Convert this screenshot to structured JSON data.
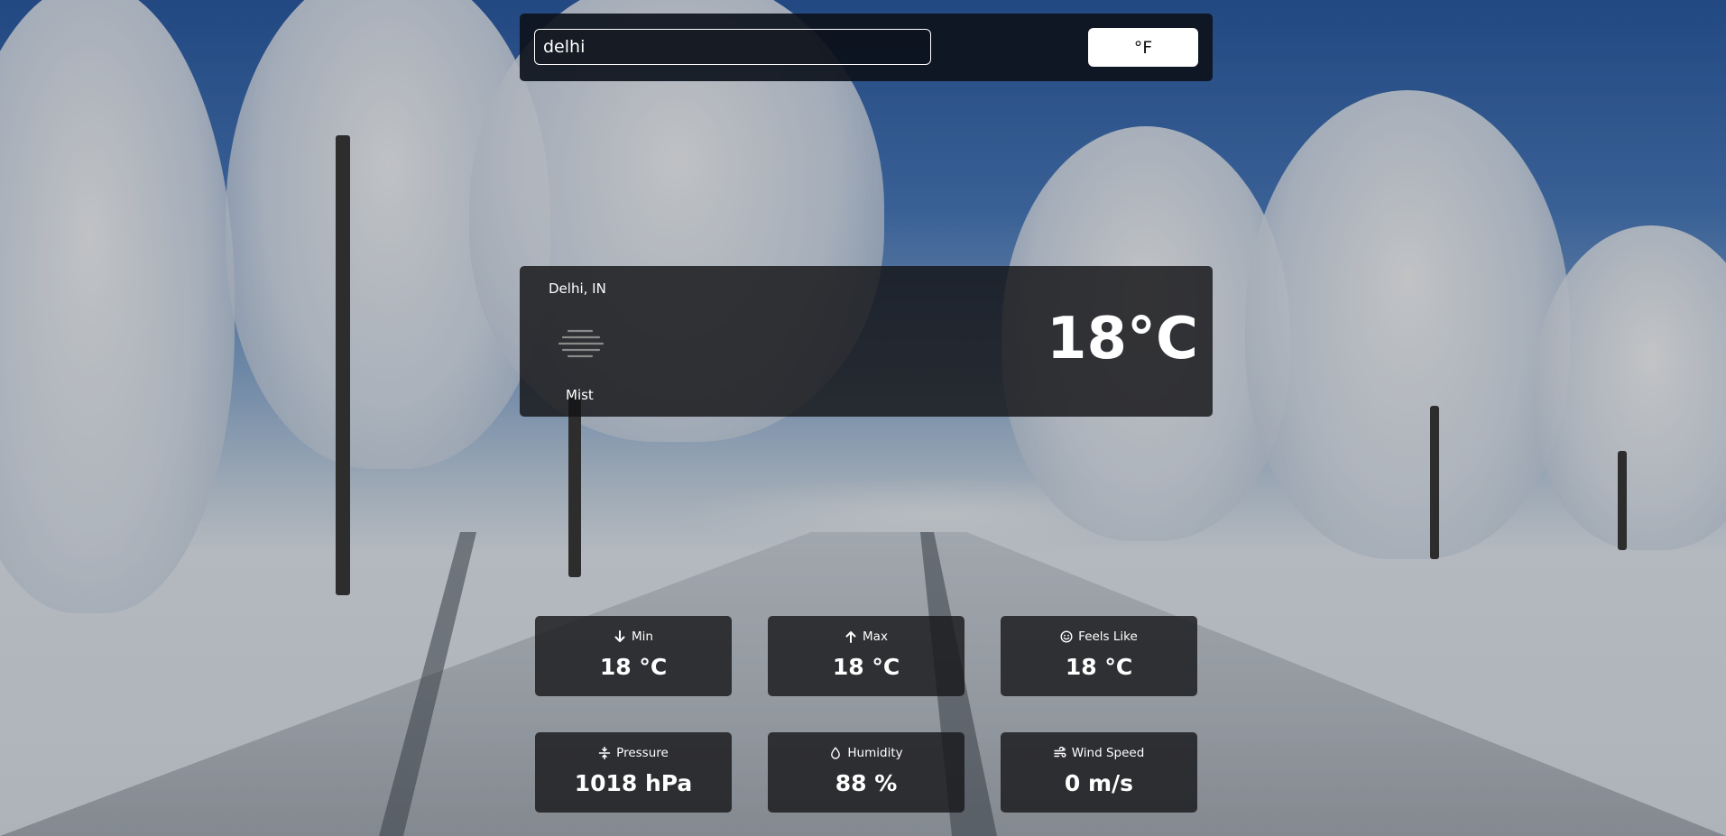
{
  "search": {
    "value": "delhi",
    "unit_toggle_label": "°F"
  },
  "current": {
    "location": "Delhi, IN",
    "temperature": "18°C",
    "condition": "Mist",
    "condition_icon": "mist-icon"
  },
  "stats": [
    {
      "label": "Min",
      "value": "18 °C",
      "icon": "arrow-down-icon"
    },
    {
      "label": "Max",
      "value": "18 °C",
      "icon": "arrow-up-icon"
    },
    {
      "label": "Feels Like",
      "value": "18 °C",
      "icon": "smiley-icon"
    },
    {
      "label": "Pressure",
      "value": "1018 hPa",
      "icon": "compress-icon"
    },
    {
      "label": "Humidity",
      "value": "88 %",
      "icon": "droplet-icon"
    },
    {
      "label": "Wind Speed",
      "value": "0 m/s",
      "icon": "wind-icon"
    }
  ]
}
